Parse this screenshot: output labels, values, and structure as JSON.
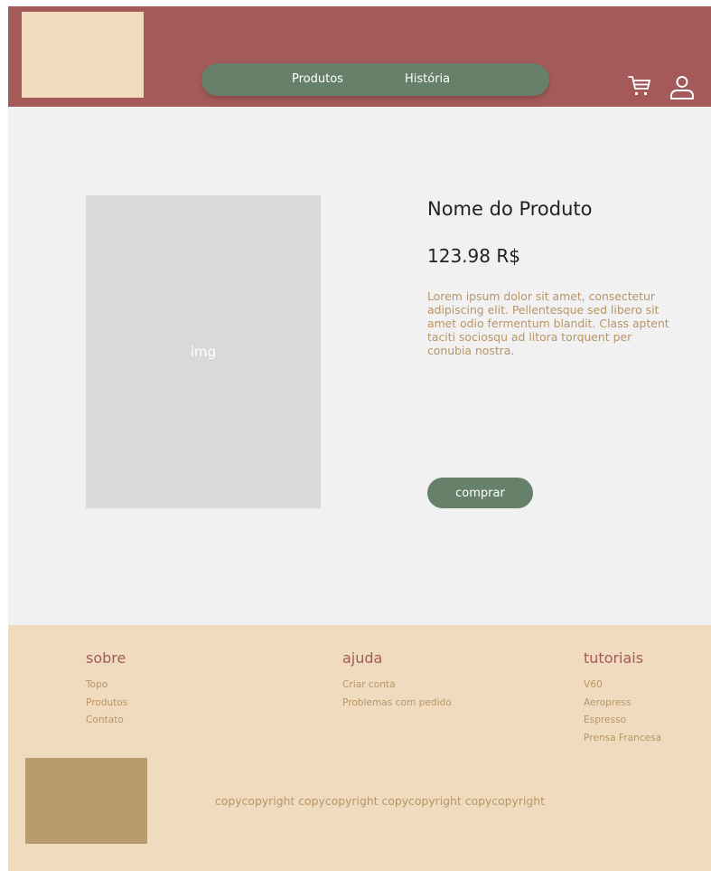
{
  "header": {
    "nav": {
      "produtos": "Produtos",
      "historia": "História"
    },
    "icons": {
      "cart": "cart-icon",
      "user": "user-icon"
    }
  },
  "product": {
    "image_label": "img",
    "name": "Nome do Produto",
    "price": "123.98 R$",
    "description": "Lorem ipsum dolor sit amet, consectetur adipiscing elit. Pellentesque sed libero sit amet odio fermentum blandit. Class aptent taciti sociosqu ad litora torquent per conubia nostra.",
    "buy_label": "comprar"
  },
  "footer": {
    "sobre": {
      "heading": "sobre",
      "links": [
        "Topo",
        "Produtos",
        "Contato"
      ]
    },
    "ajuda": {
      "heading": "ajuda",
      "links": [
        "Criar conta",
        "Problemas com pedido"
      ]
    },
    "tutoriais": {
      "heading": "tutoriais",
      "links": [
        "V60",
        "Aeropress",
        "Espresso",
        "Prensa Francesa"
      ]
    },
    "copyright": "copycopyright copycopyright copycopyright copycopyright"
  },
  "colors": {
    "header_bg": "#a35a58",
    "nav_green": "#66806a",
    "cream": "#f0dbbf",
    "logo_cream": "#f2dbbd",
    "tan": "#b89c6e",
    "text_tan": "#b89566",
    "page_bg": "#f1f1f1",
    "image_placeholder": "#d9d9d9"
  }
}
